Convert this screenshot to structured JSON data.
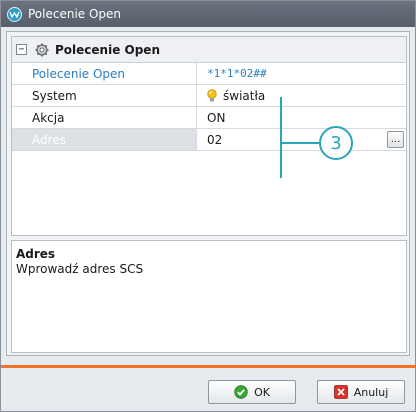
{
  "window": {
    "title": "Polecenie Open",
    "icon": "app-logo-icon"
  },
  "property_grid": {
    "group_title": "Polecenie Open",
    "collapse_symbol": "−",
    "rows": [
      {
        "name": "Polecenie Open",
        "value": "*1*1*02##",
        "style": "link"
      },
      {
        "name": "System",
        "value": "światła",
        "icon": "light-bulb-icon"
      },
      {
        "name": "Akcja",
        "value": "ON"
      },
      {
        "name": "Adres",
        "value": "02",
        "selected": true,
        "editor_button": "..."
      }
    ]
  },
  "description": {
    "title": "Adres",
    "text": "Wprowadź adres SCS"
  },
  "callout": {
    "number": "3",
    "color": "#2aa6b6"
  },
  "buttons": {
    "ok_label": "OK",
    "cancel_label": "Anuluj"
  },
  "colors": {
    "accent_orange": "#f2742a",
    "link_blue": "#2b7fc1"
  }
}
